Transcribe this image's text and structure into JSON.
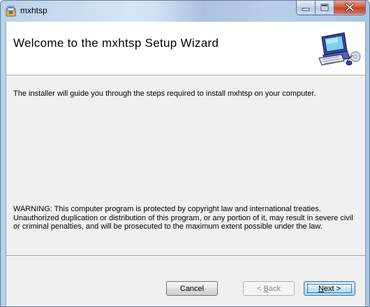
{
  "window": {
    "title": "mxhtsp",
    "caption_buttons": [
      "minimize-icon",
      "maximize-icon",
      "close-icon"
    ]
  },
  "banner": {
    "title": "Welcome to the mxhtsp Setup Wizard",
    "icon": "computer-setup-icon"
  },
  "body": {
    "intro": "The installer will guide you through the steps required to install mxhtsp on your computer.",
    "warning_lines": [
      "WARNING: This computer program is protected by copyright law and international treaties.",
      "Unauthorized duplication or distribution of this program, or any portion of it, may result in severe civil",
      "or criminal penalties, and will be prosecuted to the maximum extent possible under the law."
    ]
  },
  "buttons": {
    "cancel": "Cancel",
    "back_prefix": "< ",
    "back_mnemonic": "B",
    "back_rest": "ack",
    "next_mnemonic": "N",
    "next_rest": "ext >"
  },
  "colors": {
    "titlebar": "#b9d1ea",
    "client": "#f0f0f0",
    "banner": "#ffffff",
    "close_button": "#c7402a"
  }
}
